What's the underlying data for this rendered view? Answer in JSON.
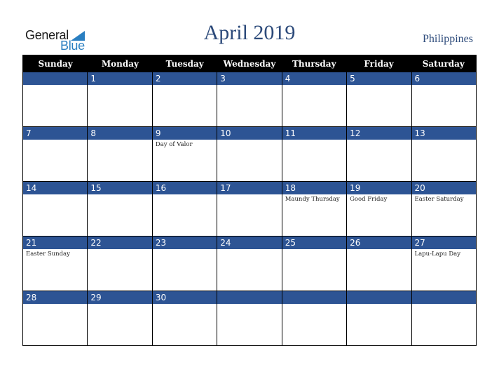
{
  "logo": {
    "line1": "General",
    "line2": "Blue",
    "accent": "#2a7fc1"
  },
  "title": "April 2019",
  "country": "Philippines",
  "colors": {
    "band": "#2d5494",
    "header": "#000000",
    "title": "#2c4a7a"
  },
  "weekdays": [
    "Sunday",
    "Monday",
    "Tuesday",
    "Wednesday",
    "Thursday",
    "Friday",
    "Saturday"
  ],
  "weeks": [
    [
      {
        "day": "",
        "holiday": ""
      },
      {
        "day": "1",
        "holiday": ""
      },
      {
        "day": "2",
        "holiday": ""
      },
      {
        "day": "3",
        "holiday": ""
      },
      {
        "day": "4",
        "holiday": ""
      },
      {
        "day": "5",
        "holiday": ""
      },
      {
        "day": "6",
        "holiday": ""
      }
    ],
    [
      {
        "day": "7",
        "holiday": ""
      },
      {
        "day": "8",
        "holiday": ""
      },
      {
        "day": "9",
        "holiday": "Day of Valor"
      },
      {
        "day": "10",
        "holiday": ""
      },
      {
        "day": "11",
        "holiday": ""
      },
      {
        "day": "12",
        "holiday": ""
      },
      {
        "day": "13",
        "holiday": ""
      }
    ],
    [
      {
        "day": "14",
        "holiday": ""
      },
      {
        "day": "15",
        "holiday": ""
      },
      {
        "day": "16",
        "holiday": ""
      },
      {
        "day": "17",
        "holiday": ""
      },
      {
        "day": "18",
        "holiday": "Maundy Thursday"
      },
      {
        "day": "19",
        "holiday": "Good Friday"
      },
      {
        "day": "20",
        "holiday": "Easter Saturday"
      }
    ],
    [
      {
        "day": "21",
        "holiday": "Easter Sunday"
      },
      {
        "day": "22",
        "holiday": ""
      },
      {
        "day": "23",
        "holiday": ""
      },
      {
        "day": "24",
        "holiday": ""
      },
      {
        "day": "25",
        "holiday": ""
      },
      {
        "day": "26",
        "holiday": ""
      },
      {
        "day": "27",
        "holiday": "Lapu-Lapu Day"
      }
    ],
    [
      {
        "day": "28",
        "holiday": ""
      },
      {
        "day": "29",
        "holiday": ""
      },
      {
        "day": "30",
        "holiday": ""
      },
      {
        "day": "",
        "holiday": ""
      },
      {
        "day": "",
        "holiday": ""
      },
      {
        "day": "",
        "holiday": ""
      },
      {
        "day": "",
        "holiday": ""
      }
    ]
  ]
}
